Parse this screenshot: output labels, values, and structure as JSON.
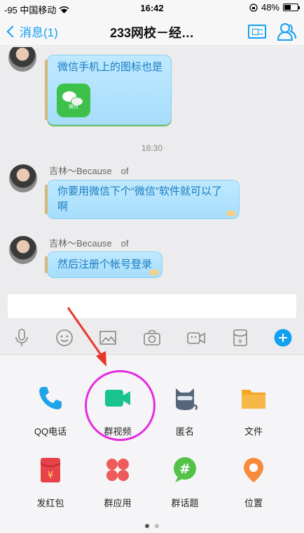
{
  "status_bar": {
    "carrier": "-95 中国移动",
    "time": "16:42",
    "battery_text": "48%",
    "battery_level": 0.48
  },
  "nav": {
    "back_label": "消息(1)",
    "title": "233网校－经…"
  },
  "chat": {
    "messages": [
      {
        "sender": "",
        "text": "微信手机上的图标也是",
        "attachment_label": "微信"
      },
      {
        "sender": "吉林～Because　of",
        "text": "你要用微信下个“微信”软件就可以了啊"
      },
      {
        "sender": "吉林～Because　of",
        "text": "然后注册个帐号登录"
      }
    ],
    "timestamp": "16:30"
  },
  "panel": {
    "items": [
      {
        "label": "QQ电话",
        "icon": "phone-icon"
      },
      {
        "label": "群视频",
        "icon": "video-camera-icon"
      },
      {
        "label": "匿名",
        "icon": "anonymous-cat-icon"
      },
      {
        "label": "文件",
        "icon": "folder-icon"
      },
      {
        "label": "发红包",
        "icon": "red-packet-icon"
      },
      {
        "label": "群应用",
        "icon": "apps-icon"
      },
      {
        "label": "群话题",
        "icon": "topic-hashtag-icon"
      },
      {
        "label": "位置",
        "icon": "location-pin-icon"
      }
    ],
    "page_count": 2,
    "current_page": 1
  },
  "colors": {
    "accent": "#12a0f0",
    "highlight": "#e52ce0",
    "arrow": "#e8372a"
  }
}
